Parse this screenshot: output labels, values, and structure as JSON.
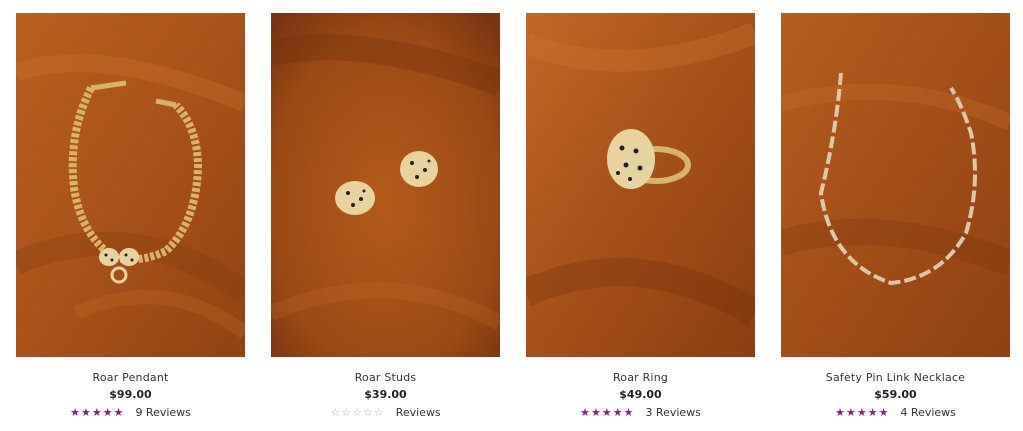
{
  "products": [
    {
      "name": "Roar Pendant",
      "price": "$99.00",
      "rating": 5,
      "reviews": "9 Reviews",
      "image": "gold-chain-necklace-with-leopard-head-clasp"
    },
    {
      "name": "Roar Studs",
      "price": "$39.00",
      "rating": 0,
      "reviews": "Reviews",
      "image": "leopard-head-stud-earrings"
    },
    {
      "name": "Roar Ring",
      "price": "$49.00",
      "rating": 5,
      "reviews": "3 Reviews",
      "image": "leopard-head-ring"
    },
    {
      "name": "Safety Pin Link Necklace",
      "price": "$59.00",
      "rating": 5,
      "reviews": "4 Reviews",
      "image": "safety-pin-link-chain-necklace"
    }
  ],
  "colors": {
    "backdrop": "#b65a1c",
    "star_filled": "#8a1e84",
    "star_empty": "#b0b0b0",
    "gold": "#d6b46a"
  }
}
